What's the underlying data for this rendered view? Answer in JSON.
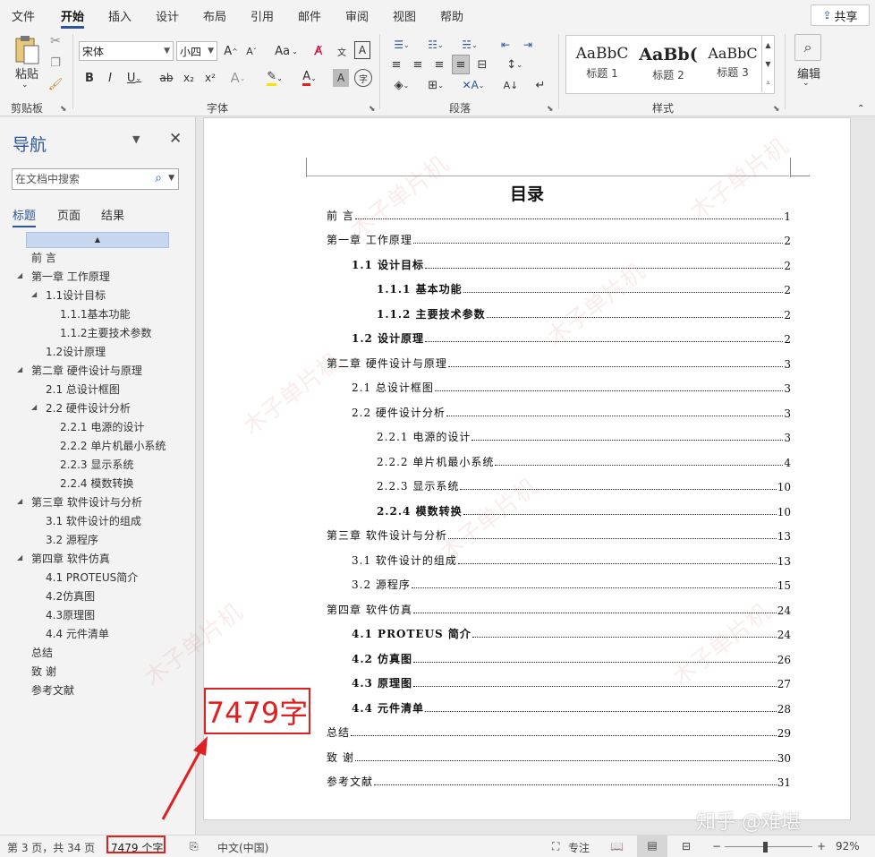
{
  "menu": {
    "tabs": [
      "文件",
      "开始",
      "插入",
      "设计",
      "布局",
      "引用",
      "邮件",
      "审阅",
      "视图",
      "帮助"
    ],
    "share_label": "共享"
  },
  "ribbon": {
    "clipboard": {
      "paste_label": "粘贴",
      "group_label": "剪贴板"
    },
    "font": {
      "font_name": "宋体",
      "font_size": "小四",
      "group_label": "字体",
      "change_case": "Aa"
    },
    "paragraph": {
      "group_label": "段落"
    },
    "styles": {
      "group_label": "样式",
      "items": [
        {
          "sample": "AaBbC",
          "name": "标题 1"
        },
        {
          "sample": "AaBb(",
          "name": "标题 2"
        },
        {
          "sample": "AaBbC",
          "name": "标题 3"
        }
      ]
    },
    "editing": {
      "label": "编辑"
    }
  },
  "nav": {
    "title": "导航",
    "search_placeholder": "在文档中搜索",
    "tabs": [
      "标题",
      "页面",
      "结果"
    ],
    "items": [
      {
        "label": "前 言"
      },
      {
        "label": "第一章  工作原理"
      },
      {
        "label": "1.1设计目标"
      },
      {
        "label": "1.1.1基本功能"
      },
      {
        "label": "1.1.2主要技术参数"
      },
      {
        "label": "1.2设计原理"
      },
      {
        "label": "第二章  硬件设计与原理"
      },
      {
        "label": "2.1 总设计框图"
      },
      {
        "label": "2.2 硬件设计分析"
      },
      {
        "label": "2.2.1 电源的设计"
      },
      {
        "label": "2.2.2 单片机最小系统"
      },
      {
        "label": "2.2.3 显示系统"
      },
      {
        "label": "2.2.4 模数转换"
      },
      {
        "label": "第三章  软件设计与分析"
      },
      {
        "label": "3.1 软件设计的组成"
      },
      {
        "label": "3.2  源程序"
      },
      {
        "label": "第四章  软件仿真"
      },
      {
        "label": "4.1 PROTEUS简介"
      },
      {
        "label": "4.2仿真图"
      },
      {
        "label": "4.3原理图"
      },
      {
        "label": "4.4 元件清单"
      },
      {
        "label": "总结"
      },
      {
        "label": "致  谢"
      },
      {
        "label": "参考文献"
      }
    ]
  },
  "doc": {
    "toc_title": "目录",
    "toc": [
      {
        "text": "前  言",
        "page": "1",
        "bold": false
      },
      {
        "text": "第一章  工作原理",
        "page": "2",
        "bold": false
      },
      {
        "text": "1.1 设计目标",
        "page": "2",
        "bold": true
      },
      {
        "text": "1.1.1 基本功能",
        "page": "2",
        "bold": true
      },
      {
        "text": "1.1.2 主要技术参数",
        "page": "2",
        "bold": true
      },
      {
        "text": "1.2 设计原理",
        "page": "2",
        "bold": true
      },
      {
        "text": "第二章  硬件设计与原理",
        "page": "3",
        "bold": false
      },
      {
        "text": "2.1 总设计框图",
        "page": "3",
        "bold": false
      },
      {
        "text": "2.2 硬件设计分析",
        "page": "3",
        "bold": false
      },
      {
        "text": "2.2.1 电源的设计",
        "page": "3",
        "bold": false
      },
      {
        "text": "2.2.2 单片机最小系统",
        "page": "4",
        "bold": false
      },
      {
        "text": "2.2.3 显示系统",
        "page": "10",
        "bold": false
      },
      {
        "text": "2.2.4 模数转换",
        "page": "10",
        "bold": true
      },
      {
        "text": "第三章  软件设计与分析",
        "page": "13",
        "bold": false
      },
      {
        "text": "3.1 软件设计的组成",
        "page": "13",
        "bold": false
      },
      {
        "text": "3.2   源程序",
        "page": "15",
        "bold": false
      },
      {
        "text": "第四章  软件仿真",
        "page": "24",
        "bold": false
      },
      {
        "text": "4.1 PROTEUS 简介",
        "page": "24",
        "bold": true
      },
      {
        "text": "4.2 仿真图",
        "page": "26",
        "bold": true
      },
      {
        "text": "4.3 原理图",
        "page": "27",
        "bold": true
      },
      {
        "text": "4.4 元件清单",
        "page": "28",
        "bold": true
      },
      {
        "text": "总结",
        "page": "29",
        "bold": false
      },
      {
        "text": "致  谢",
        "page": "30",
        "bold": false
      },
      {
        "text": "参考文献",
        "page": "31",
        "bold": false
      }
    ]
  },
  "annotation": {
    "callout": "7479字",
    "color": "#e02020"
  },
  "watermark": {
    "text": "木子单片机",
    "brand": "知乎 @难堪"
  },
  "status": {
    "page": "第 3 页，共 34 页",
    "words": "7479 个字",
    "language": "中文(中国)",
    "focus": "专注",
    "zoom": "92%",
    "zoom_minus": "−",
    "zoom_plus": "+"
  },
  "colors": {
    "accent": "#2b579a"
  }
}
